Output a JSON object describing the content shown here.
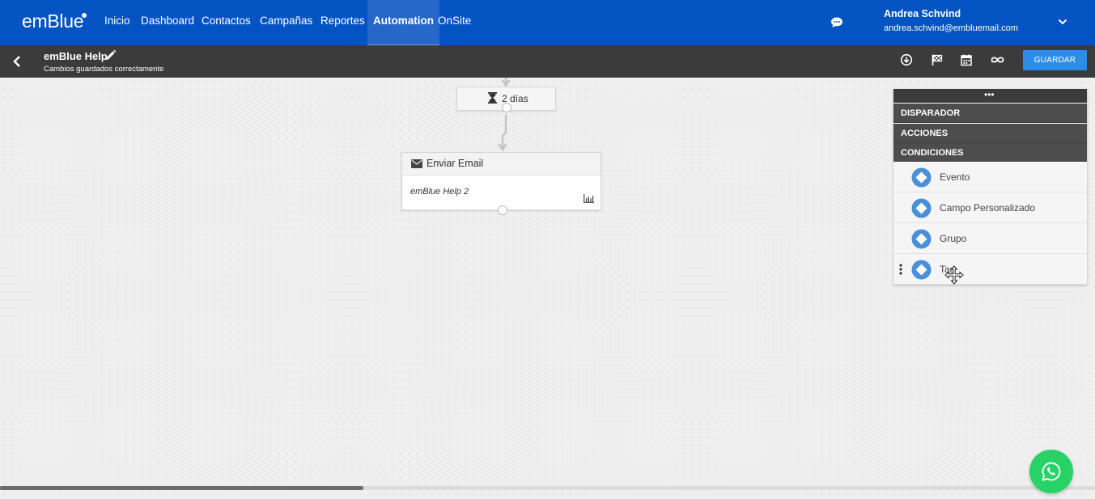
{
  "app": {
    "logo": "emBlue"
  },
  "nav": {
    "items": [
      {
        "label": "Inicio"
      },
      {
        "label": "Dashboard"
      },
      {
        "label": "Contactos"
      },
      {
        "label": "Campañas"
      },
      {
        "label": "Reportes"
      },
      {
        "label": "Automation",
        "active": true
      },
      {
        "label": "OnSite"
      }
    ]
  },
  "user": {
    "name": "Andrea Schvind",
    "email": "andrea.schvind@embluemail.com"
  },
  "subheader": {
    "title": "emBlue Help",
    "status": "Cambios guardados correctamente",
    "save_label": "GUARDAR",
    "tools": [
      "download-icon",
      "flag-icon",
      "calendar-icon",
      "infinity-icon"
    ]
  },
  "flow": {
    "wait_node": {
      "label": "2 días"
    },
    "email_node": {
      "title": "Enviar Email",
      "subtitle": "emBlue Help 2"
    }
  },
  "panel": {
    "sections": [
      "DISPARADOR",
      "ACCIONES",
      "CONDICIONES"
    ],
    "items": [
      {
        "label": "Evento"
      },
      {
        "label": "Campo Personalizado"
      },
      {
        "label": "Grupo"
      },
      {
        "label": "Tag"
      }
    ]
  },
  "colors": {
    "nav_bg": "#0353c2",
    "nav_active": "#2667c9",
    "subbar_bg": "#3b3b3b",
    "save_button": "#2c8de8",
    "diamond": "#4a90d9",
    "whatsapp": "#27d366"
  }
}
